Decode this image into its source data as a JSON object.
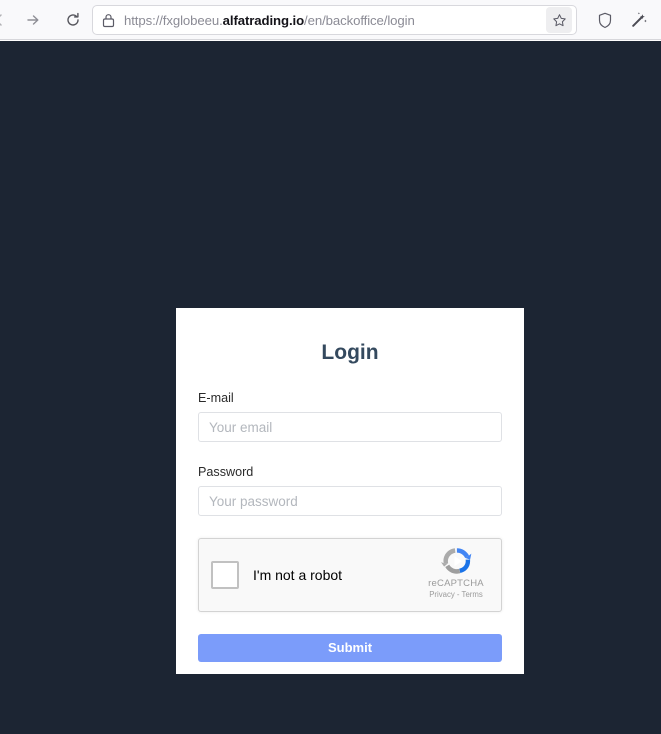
{
  "browser": {
    "back_label": "Back",
    "forward_label": "Forward",
    "reload_label": "Reload",
    "url_prefix": "https://fxglobeeu.",
    "url_host": "alfatrading.io",
    "url_path": "/en/backoffice/login",
    "url_full": "https://fxglobeeu.alfatrading.io/en/backoffice/login",
    "lock_icon": "padlock-icon",
    "bookmark_icon": "star-icon",
    "shield_icon": "shield-icon",
    "extension_icon": "magic-wand-icon"
  },
  "page": {
    "background_color": "#1c2533"
  },
  "login": {
    "title": "Login",
    "email": {
      "label": "E-mail",
      "placeholder": "Your email",
      "value": ""
    },
    "password": {
      "label": "Password",
      "placeholder": "Your password",
      "value": ""
    },
    "recaptcha": {
      "checkbox_label": "I'm not a robot",
      "brand": "reCAPTCHA",
      "terms": "Privacy - Terms",
      "checked": false
    },
    "submit_label": "Submit",
    "accent_color": "#7b9cfa",
    "title_color": "#34495e"
  }
}
